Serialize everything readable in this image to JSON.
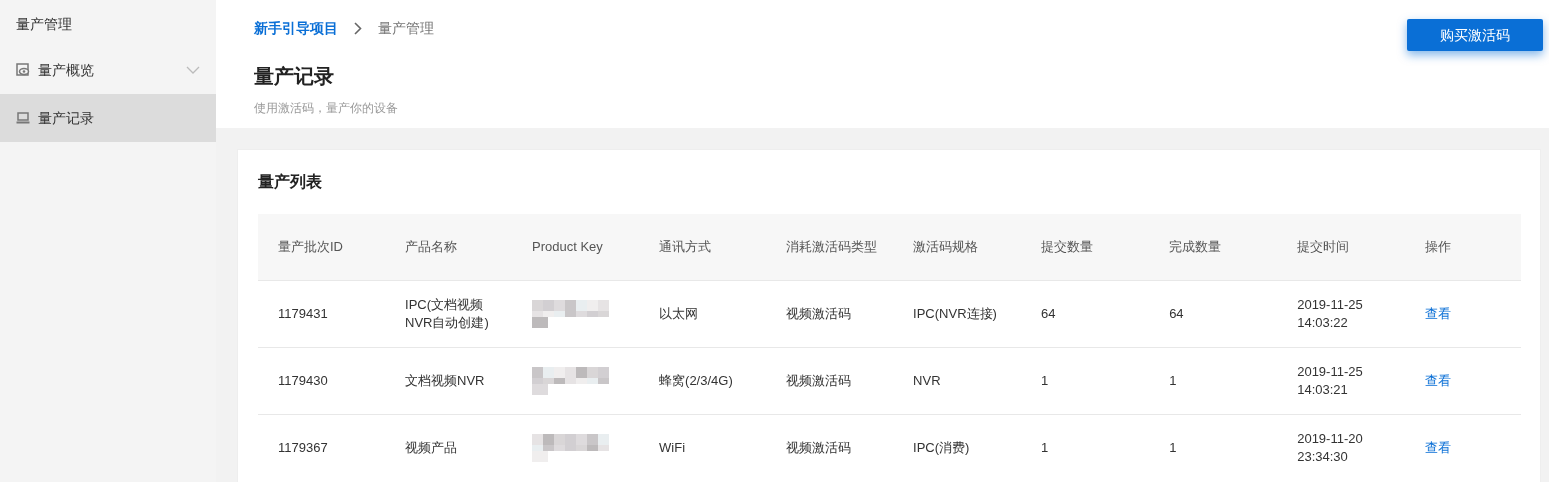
{
  "sidebar": {
    "title": "量产管理",
    "items": [
      {
        "label": "量产概览",
        "expandable": true,
        "selected": false
      },
      {
        "label": "量产记录",
        "expandable": false,
        "selected": true
      }
    ]
  },
  "breadcrumb": [
    {
      "label": "新手引导项目",
      "kind": "link"
    },
    {
      "label": "量产管理",
      "kind": "current"
    }
  ],
  "page": {
    "title": "量产记录",
    "subtitle": "使用激活码，量产你的设备",
    "action": "购买激活码"
  },
  "card": {
    "title": "量产列表"
  },
  "table": {
    "columns": [
      "量产批次ID",
      "产品名称",
      "Product Key",
      "通讯方式",
      "消耗激活码类型",
      "激活码规格",
      "提交数量",
      "完成数量",
      "提交时间",
      "操作"
    ],
    "rows": [
      {
        "id": "1179431",
        "name": "IPC(文档视频NVR自动创建)",
        "comm": "以太网",
        "type": "视频激活码",
        "spec": "IPC(NVR连接)",
        "submitted": "64",
        "done": "64",
        "time": "2019-11-25 14:03:22",
        "action": "查看"
      },
      {
        "id": "1179430",
        "name": "文档视频NVR",
        "comm": "蜂窝(2/3/4G)",
        "type": "视频激活码",
        "spec": "NVR",
        "submitted": "1",
        "done": "1",
        "time": "2019-11-25 14:03:21",
        "action": "查看"
      },
      {
        "id": "1179367",
        "name": "视频产品",
        "comm": "WiFi",
        "type": "视频激活码",
        "spec": "IPC(消费)",
        "submitted": "1",
        "done": "1",
        "time": "2019-11-20 23:34:30",
        "action": "查看"
      }
    ]
  }
}
